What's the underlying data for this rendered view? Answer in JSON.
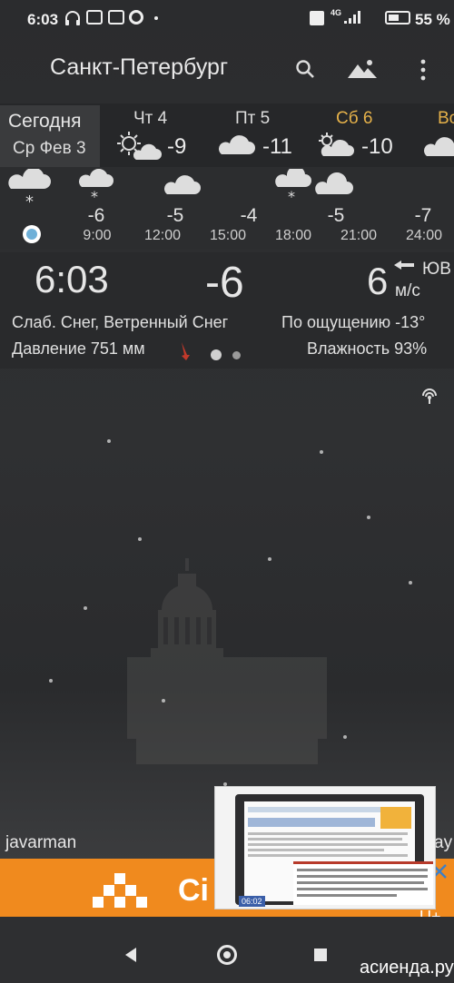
{
  "status_bar": {
    "time": "6:03",
    "network": "4G",
    "battery_percent": "55 %",
    "battery_level": 0.55
  },
  "toolbar": {
    "city": "Санкт-Петербург"
  },
  "daily": [
    {
      "line1": "Сегодня",
      "line2": "Ср Фев 3"
    },
    {
      "day": "Чт 4",
      "temp": "-9",
      "icon": "partly-cloudy-sun-icon"
    },
    {
      "day": "Пт 5",
      "temp": "-11",
      "icon": "cloudy-icon"
    },
    {
      "day": "Сб 6",
      "temp": "-10",
      "icon": "partly-cloudy-sun-icon",
      "highlight_color": "#e6b24a"
    },
    {
      "day": "Вс",
      "temp": "",
      "icon": "cloudy-icon"
    }
  ],
  "hourly": [
    {
      "temp": "",
      "time": "",
      "icon": "snow-cloud-icon"
    },
    {
      "temp": "-6",
      "time": "9:00",
      "icon": "snow-cloud-icon"
    },
    {
      "temp": "-5",
      "time": "12:00",
      "icon": "cloudy-icon"
    },
    {
      "temp": "-4",
      "time": "15:00",
      "icon": ""
    },
    {
      "temp": "-5",
      "time": "18:00",
      "icon": "snow-cloud-icon"
    },
    {
      "temp": "-5",
      "time": "21:00",
      "icon": "cloudy-icon"
    },
    {
      "temp": "-7",
      "time": "24:00",
      "icon": ""
    }
  ],
  "current": {
    "time": "6:03",
    "temp": "-6",
    "wind_speed": "6",
    "wind_dir": "ЮВ",
    "wind_unit": "м/с",
    "condition": "Слаб. Снег, Ветренный Снег",
    "feels_like": "По ощущению -13°",
    "pressure": "Давление 751 мм",
    "humidity": "Влажность 93%"
  },
  "ad": {
    "attribution": "javarman",
    "attribution_right": "ay",
    "banner_text": "Сі",
    "banner_suffix": "U+",
    "brand_color": "#f08a1e",
    "video_time": "06:02"
  },
  "watermark": "асиенда.ру"
}
